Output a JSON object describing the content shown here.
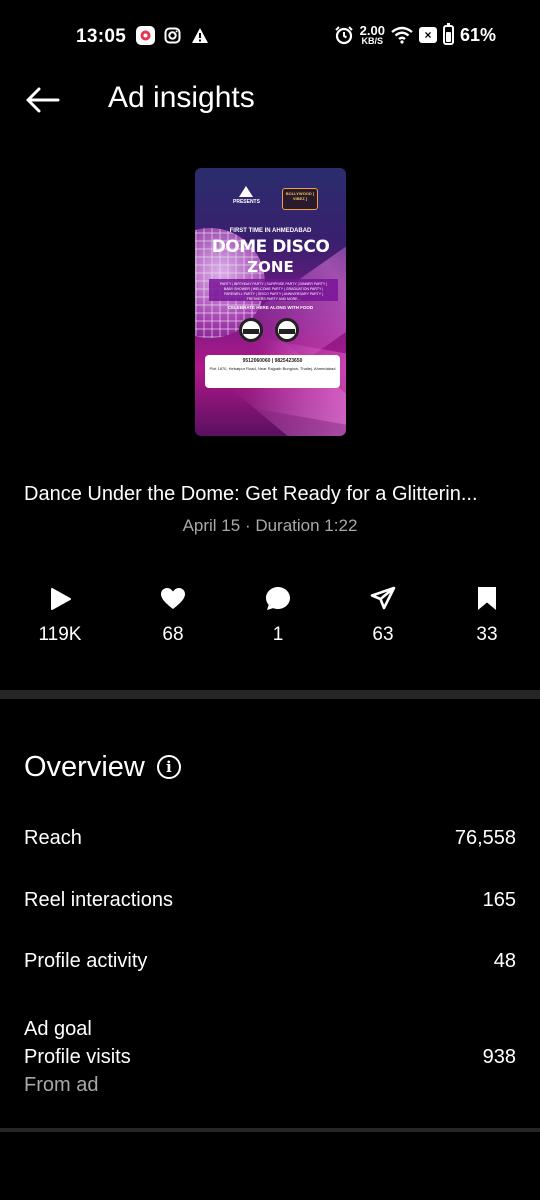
{
  "status_bar": {
    "time": "13:05",
    "speed_value": "2.00",
    "speed_unit": "KB/S",
    "battery": "61%",
    "battery_level": 0.61
  },
  "header": {
    "title": "Ad insights"
  },
  "thumbnail": {
    "presents": "PRESENTS",
    "badge": "BOLLYWOOD [ VIBEZ ]",
    "subtitle": "FIRST TIME IN AHMEDABAD",
    "title_line1": "DOME DISCO",
    "title_line2": "ZONE",
    "band_text": "PARTY | BIRTHDAY PARTY | SURPRISE PARTY | DINNER PARTY | BABY SHOWER | WELCOME PARTY | GRADUATION PARTY | FAREWELL PARTY | DISCO PARTY | ANNIVERSARY PARTY | FRESHERS PARTY AND MORE...",
    "celebrate": "CELEBRATE HERE ALONG WITH FOOD",
    "phones": "9512060060 | 9825423650",
    "address": "Plot 1870, Hebatpur Road, Near Rajpath Bunglow, Thaltej, Ahmedabad"
  },
  "post": {
    "title": "Dance Under the Dome: Get Ready for a Glitterin...",
    "meta": "April 15 · Duration 1:22"
  },
  "stats": {
    "plays": "119K",
    "likes": "68",
    "comments": "1",
    "shares": "63",
    "saves": "33"
  },
  "overview": {
    "title": "Overview",
    "reach_label": "Reach",
    "reach_value": "76,558",
    "interactions_label": "Reel interactions",
    "interactions_value": "165",
    "profile_activity_label": "Profile activity",
    "profile_activity_value": "48",
    "ad_goal_label": "Ad goal",
    "profile_visits_label": "Profile visits",
    "profile_visits_value": "938",
    "from_ad_label": "From ad"
  }
}
